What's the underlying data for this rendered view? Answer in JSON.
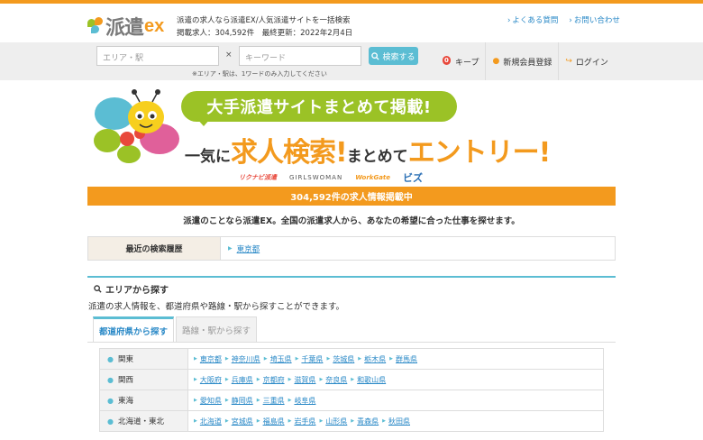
{
  "header": {
    "logo_text": "派遣",
    "logo_ex": "ex",
    "tagline": "派遣の求人なら派遣EX/人気派遣サイトを一括検索",
    "stats": "掲載求人：304,592件　最終更新：2022年2月4日",
    "links": [
      {
        "label": "よくある質問"
      },
      {
        "label": "お問い合わせ"
      }
    ]
  },
  "search": {
    "area_placeholder": "エリア・駅",
    "times": "×",
    "keyword_placeholder": "キーワード",
    "button_label": "検索する",
    "note": "※エリア・駅は、1ワードのみ入力してください"
  },
  "nav": {
    "keep_count": "0",
    "keep_label": "キープ",
    "register_label": "新規会員登録",
    "login_label": "ログイン"
  },
  "hero": {
    "bubble": "大手派遣サイトまとめて掲載!",
    "catch_1": "一気に",
    "catch_2": "求人検索!",
    "catch_3": "まとめて",
    "catch_4": "エントリー!",
    "partners": [
      "リクナビ派遣",
      "GIRLSWOMAN",
      "WorkGate",
      "ビズ"
    ]
  },
  "count_bar": "304,592件の求人情報掲載中",
  "tagline": "派遣のことなら派遣EX。全国の派遣求人から、あなたの希望に合った仕事を探せます。",
  "history": {
    "label": "最近の検索履歴",
    "item": "東京都"
  },
  "area": {
    "title": "エリアから探す",
    "description": "派遣の求人情報を、都道府県や路線・駅から探すことができます。",
    "tabs": [
      {
        "label": "都道府県から探す"
      },
      {
        "label": "路線・駅から探す"
      }
    ],
    "regions": [
      {
        "name": "関東",
        "prefs": [
          "東京都",
          "神奈川県",
          "埼玉県",
          "千葉県",
          "茨城県",
          "栃木県",
          "群馬県"
        ]
      },
      {
        "name": "関西",
        "prefs": [
          "大阪府",
          "兵庫県",
          "京都府",
          "滋賀県",
          "奈良県",
          "和歌山県"
        ]
      },
      {
        "name": "東海",
        "prefs": [
          "愛知県",
          "静岡県",
          "三重県",
          "岐阜県"
        ]
      },
      {
        "name": "北海道・東北",
        "prefs": [
          "北海道",
          "宮城県",
          "福島県",
          "岩手県",
          "山形県",
          "青森県",
          "秋田県"
        ]
      }
    ]
  },
  "colors": {
    "accent_orange": "#f39a1e",
    "accent_teal": "#5bbdd3",
    "accent_green": "#9bc226",
    "link_blue": "#2a89c7"
  }
}
